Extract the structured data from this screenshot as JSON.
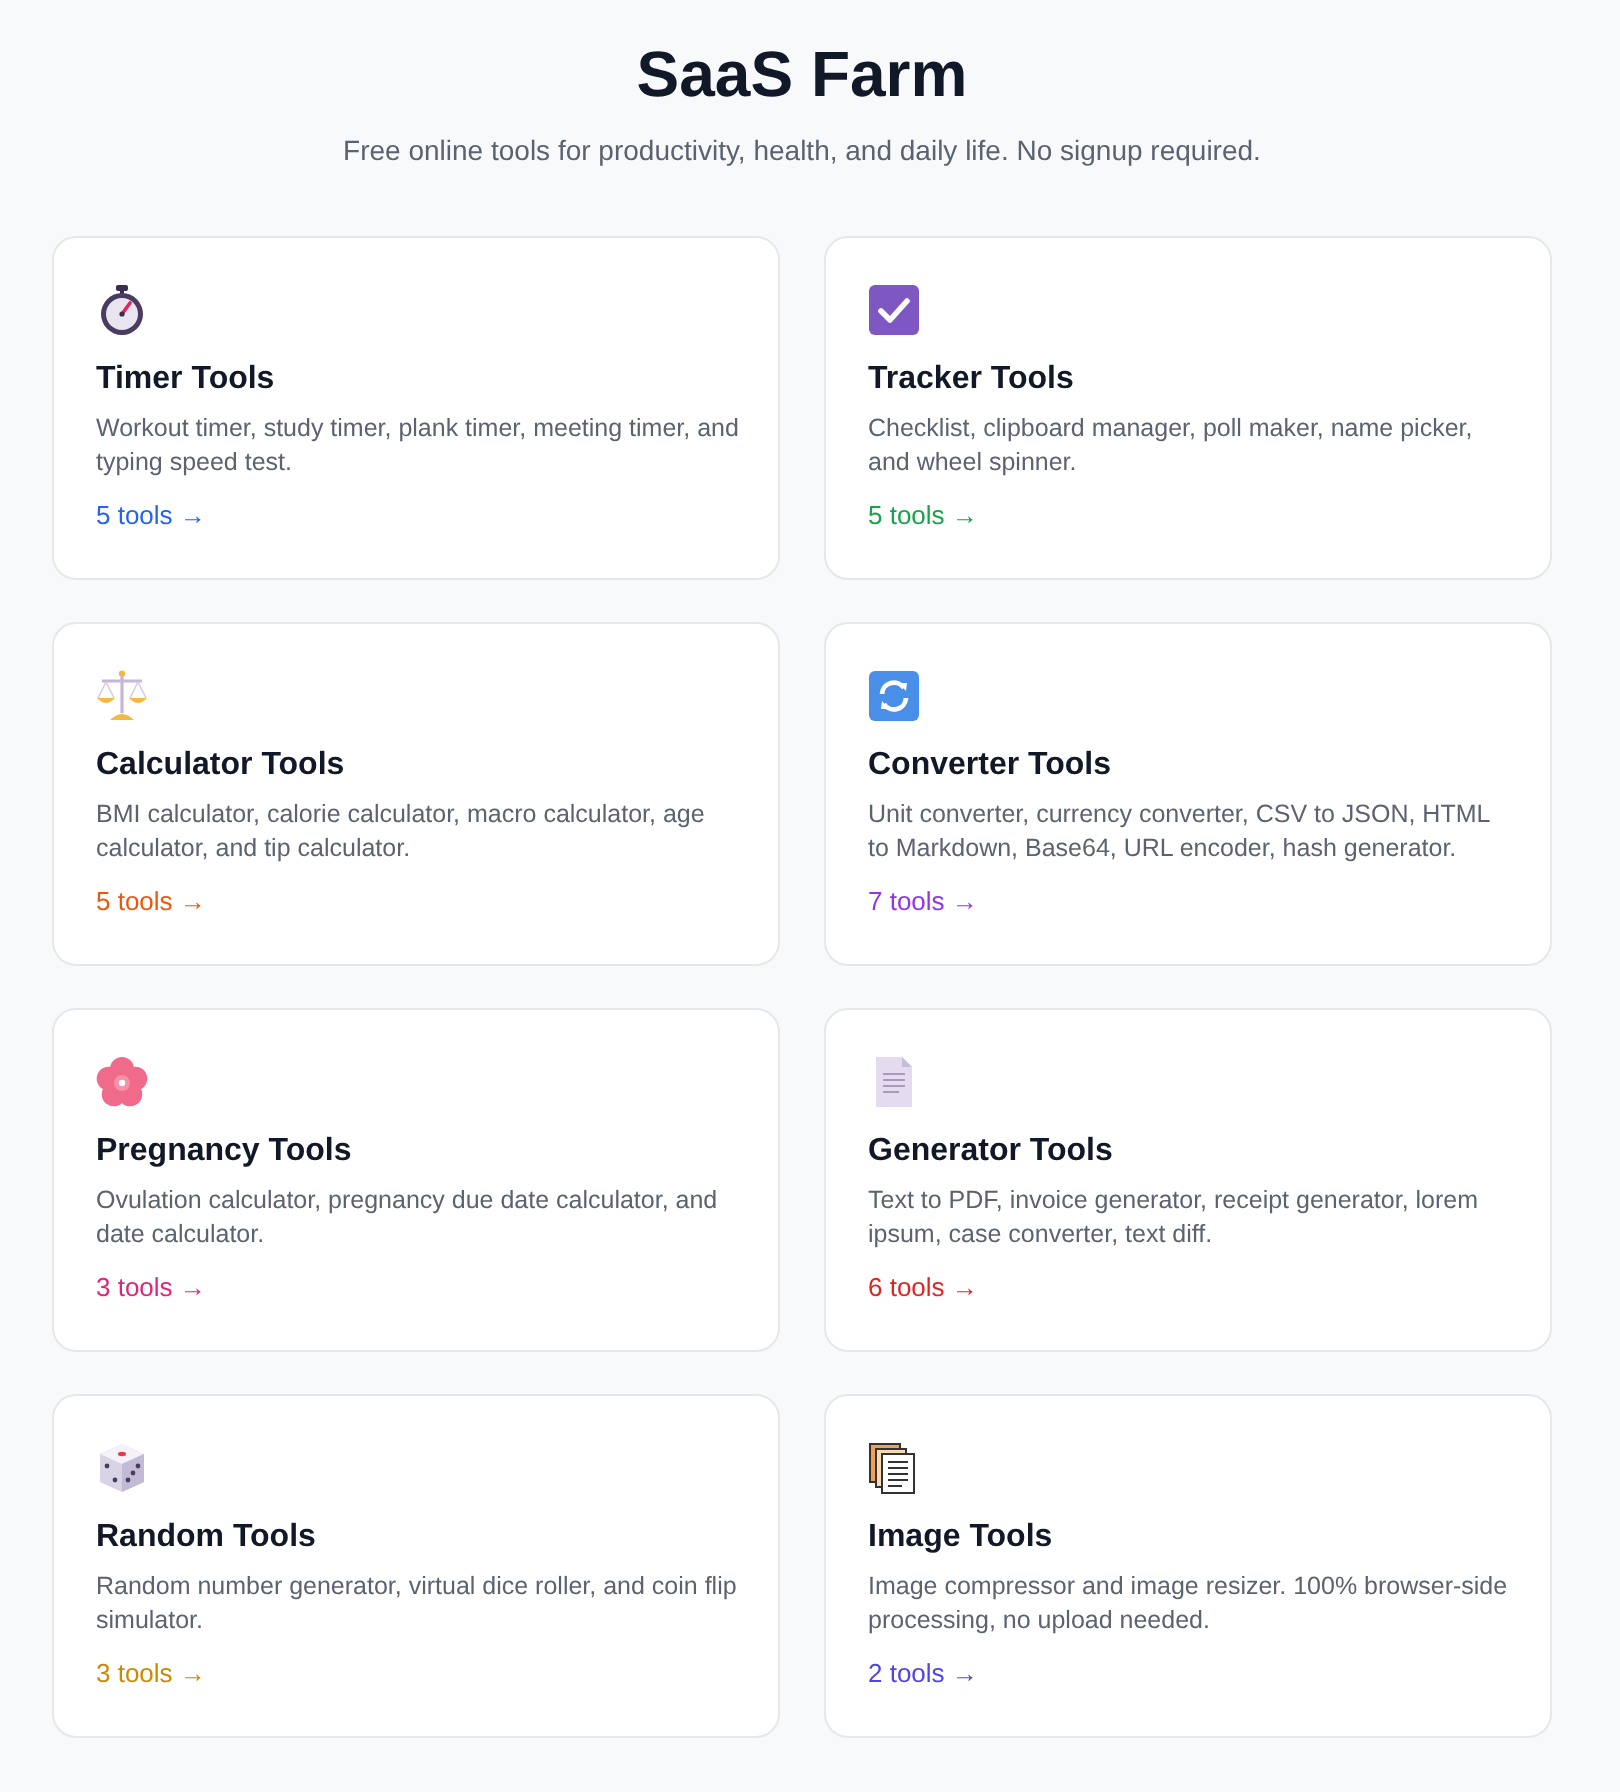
{
  "header": {
    "title": "SaaS Farm",
    "subtitle": "Free online tools for productivity, health, and daily life. No signup required."
  },
  "categories": [
    {
      "kind": "timer",
      "title": "Timer Tools",
      "description": "Workout timer, study timer, plank timer, meeting timer, and typing speed test.",
      "count": "5 tools →",
      "color": "#2563eb"
    },
    {
      "kind": "tracker",
      "title": "Tracker Tools",
      "description": "Checklist, clipboard manager, poll maker, name picker, and wheel spinner.",
      "count": "5 tools →",
      "color": "#16a34a"
    },
    {
      "kind": "calculator",
      "title": "Calculator Tools",
      "description": "BMI calculator, calorie calculator, macro calculator, age calculator, and tip calculator.",
      "count": "5 tools →",
      "color": "#ea580c"
    },
    {
      "kind": "converter",
      "title": "Converter Tools",
      "description": "Unit converter, currency converter, CSV to JSON, HTML to Markdown, Base64, URL encoder, hash generator.",
      "count": "7 tools →",
      "color": "#9333ea"
    },
    {
      "kind": "pregnancy",
      "title": "Pregnancy Tools",
      "description": "Ovulation calculator, pregnancy due date calculator, and date calculator.",
      "count": "3 tools →",
      "color": "#db2777"
    },
    {
      "kind": "generator",
      "title": "Generator Tools",
      "description": "Text to PDF, invoice generator, receipt generator, lorem ipsum, case converter, text diff.",
      "count": "6 tools →",
      "color": "#dc2626"
    },
    {
      "kind": "random",
      "title": "Random Tools",
      "description": "Random number generator, virtual dice roller, and coin flip simulator.",
      "count": "3 tools →",
      "color": "#ca8a04"
    },
    {
      "kind": "image",
      "title": "Image Tools",
      "description": "Image compressor and image resizer. 100% browser-side processing, no upload needed.",
      "count": "2 tools →",
      "color": "#4f46e5"
    }
  ]
}
